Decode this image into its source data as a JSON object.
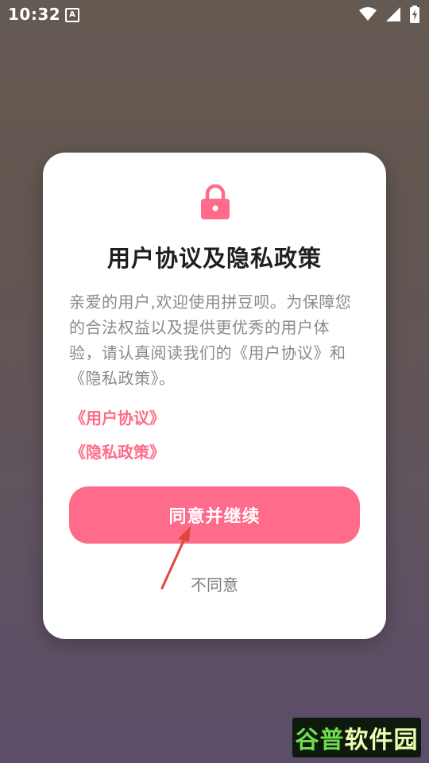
{
  "status_bar": {
    "time": "10:32",
    "notification_icon_text": "A",
    "icons": [
      "wifi-icon",
      "cell-signal-icon",
      "battery-charging-icon"
    ]
  },
  "dialog": {
    "icon": "lock-icon",
    "title": "用户协议及隐私政策",
    "body": "亲爱的用户,欢迎使用拼豆呗。为保障您的合法权益以及提供更优秀的用户体验，请认真阅读我们的《用户协议》和《隐私政策》。",
    "link_user_agreement": "《用户协议》",
    "link_privacy_policy": "《隐私政策》",
    "agree_button": "同意并继续",
    "disagree_button": "不同意"
  },
  "watermark": {
    "part1": "谷普",
    "part2": "软件园"
  },
  "colors": {
    "accent": "#ff6b8a",
    "background_top": "#655a52",
    "background_bottom": "#5c4d69",
    "arrow": "#e0473a"
  }
}
